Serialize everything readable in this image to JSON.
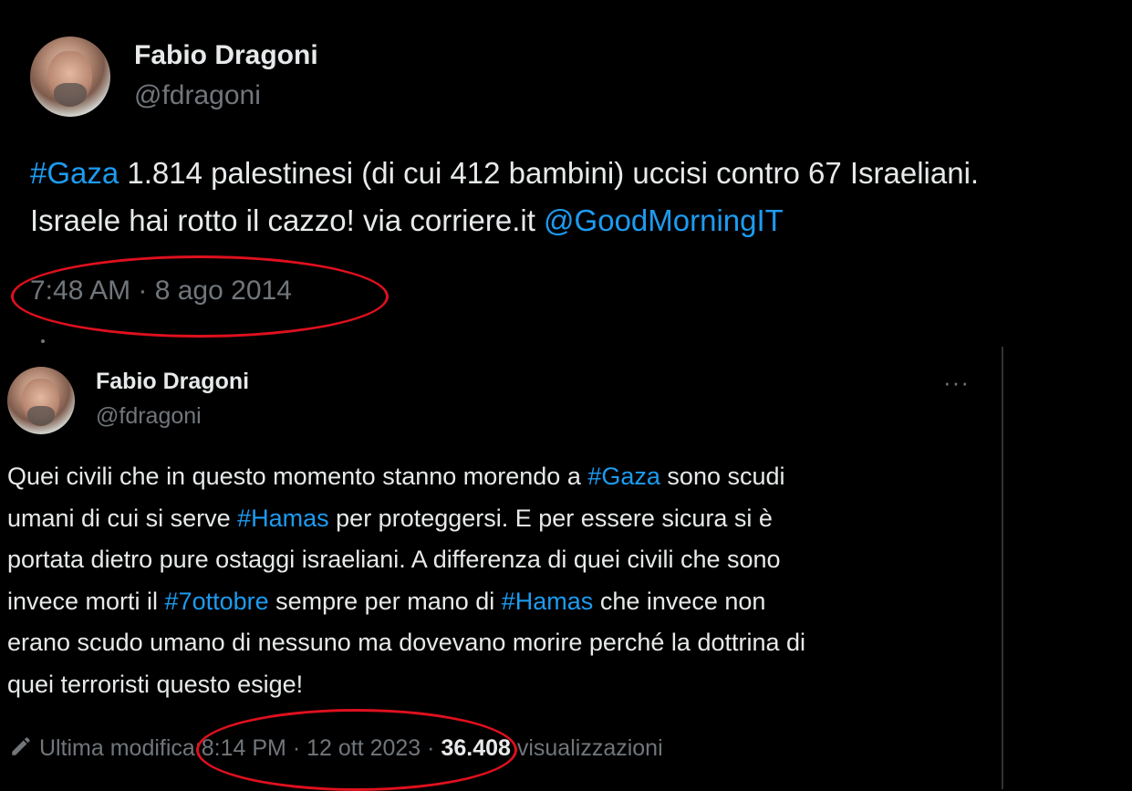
{
  "tweet1": {
    "author_name": "Fabio Dragoni",
    "author_handle": "@fdragoni",
    "text_parts": {
      "p1": "#Gaza",
      "p2": " 1.814 palestinesi (di cui 412 bambini) uccisi contro 67 Israeliani.",
      "p3": "Israele hai rotto il cazzo! via corriere.it ",
      "p4": "@GoodMorningIT"
    },
    "timestamp": "7:48 AM · 8 ago 2014"
  },
  "tweet2": {
    "author_name": "Fabio Dragoni",
    "author_handle": "@fdragoni",
    "more_label": "···",
    "lines": {
      "l1a": "Quei civili che in questo momento stanno morendo a ",
      "l1b": "#Gaza",
      "l1c": " sono scudi",
      "l2a": "umani di cui si serve ",
      "l2b": "#Hamas",
      "l2c": " per proteggersi.  E per essere sicura si è",
      "l3": "portata dietro pure ostaggi israeliani. A differenza di quei civili che sono",
      "l4a": "invece morti il ",
      "l4b": "#7ottobre",
      "l4c": " sempre per mano di ",
      "l4d": "#Hamas",
      "l4e": " che invece non",
      "l5": "erano scudo umano di nessuno ma dovevano morire perché la dottrina di",
      "l6": "quei terroristi questo esige!"
    },
    "edit_label": "Ultima modifica:",
    "timestamp": "8:14 PM · 12 ott 2023 · ",
    "views_count": "36.408",
    "views_label": " visualizzazioni"
  },
  "icons": {
    "edit": "pencil-icon",
    "more": "more-options-icon"
  },
  "colors": {
    "background": "#000000",
    "text": "#e7e9ea",
    "secondary": "#71767b",
    "link": "#1d9bf0",
    "annotation": "#e0101e"
  }
}
